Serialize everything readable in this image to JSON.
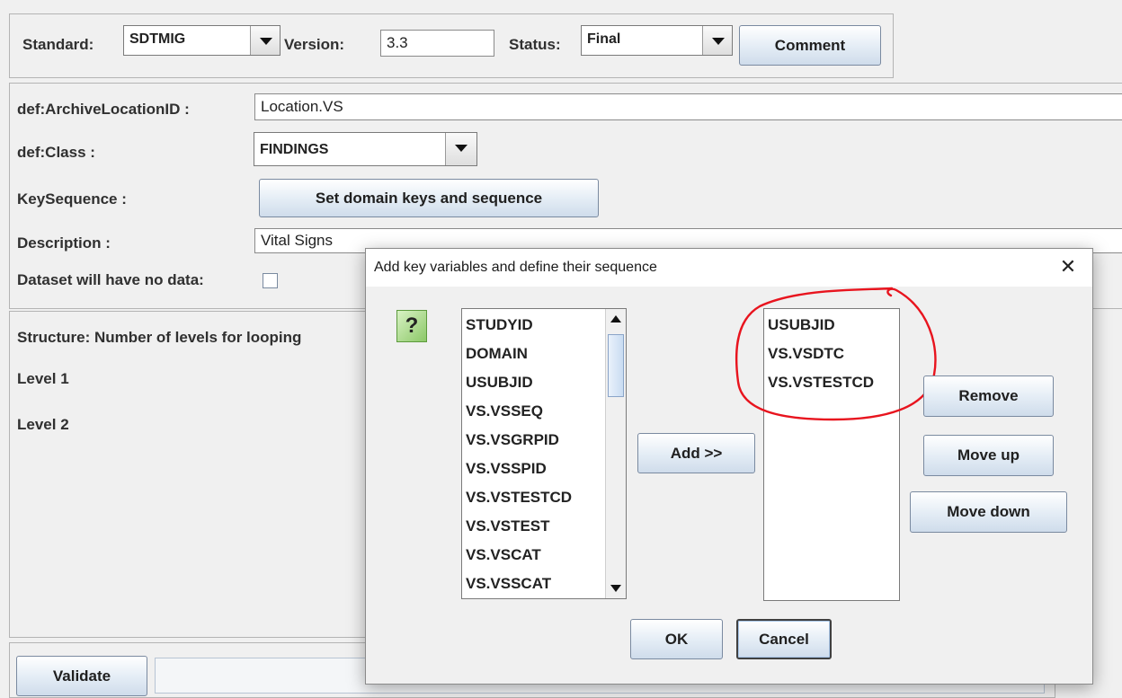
{
  "toolbar": {
    "standard_label": "Standard:",
    "standard_value": "SDTMIG",
    "version_label": "Version:",
    "version_value": "3.3",
    "status_label": "Status:",
    "status_value": "Final",
    "comment_button": "Comment"
  },
  "form": {
    "archive_label": "def:ArchiveLocationID :",
    "archive_value": "Location.VS",
    "class_label": "def:Class :",
    "class_value": "FINDINGS",
    "keyseq_label": "KeySequence :",
    "keyseq_button": "Set domain keys and sequence",
    "description_label": "Description :",
    "description_value": "Vital Signs",
    "nodata_label": "Dataset will have no data:"
  },
  "structure": {
    "title": "Structure: Number of levels for looping",
    "level1": "Level 1",
    "level2": "Level 2"
  },
  "footer": {
    "validate_button": "Validate"
  },
  "dialog": {
    "title": "Add key variables and define their sequence",
    "close_glyph": "✕",
    "help_glyph": "?",
    "available_variables": [
      "STUDYID",
      "DOMAIN",
      "USUBJID",
      "VS.VSSEQ",
      "VS.VSGRPID",
      "VS.VSSPID",
      "VS.VSTESTCD",
      "VS.VSTEST",
      "VS.VSCAT",
      "VS.VSSCAT"
    ],
    "selected_variables": [
      "USUBJID",
      "VS.VSDTC",
      "VS.VSTESTCD"
    ],
    "add_button": "Add >>",
    "remove_button": "Remove",
    "move_up_button": "Move up",
    "move_down_button": "Move down",
    "ok_button": "OK",
    "cancel_button": "Cancel",
    "annotation_color": "#e8141e"
  }
}
